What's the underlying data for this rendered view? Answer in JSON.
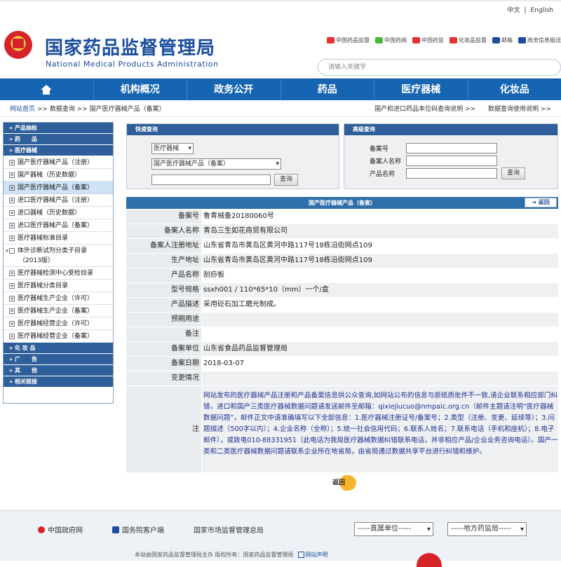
{
  "topbar": {
    "lang_cn": "中文",
    "sep": "|",
    "lang_en": "English"
  },
  "header": {
    "title_cn": "国家药品监督管理局",
    "title_en": "National Medical Products Administration",
    "quick_links": [
      {
        "label": "中国药品监督",
        "icon": "weibo-icon",
        "color": "#e5312f"
      },
      {
        "label": "中国药闻",
        "icon": "wechat-icon",
        "color": "#4bb43a"
      },
      {
        "label": "中国药监",
        "icon": "weibo-icon",
        "color": "#e5312f"
      },
      {
        "label": "化妆品监督",
        "icon": "weibo-icon",
        "color": "#e5312f"
      },
      {
        "label": "邮箱",
        "icon": "mail-icon",
        "color": "#1a4e9d"
      },
      {
        "label": "政务信息报送",
        "icon": "report-icon",
        "color": "#1a4e9d"
      }
    ],
    "search_placeholder": "请输入关键字"
  },
  "nav": {
    "home_icon": "home-icon",
    "items": [
      "机构概况",
      "政务公开",
      "药品",
      "医疗器械",
      "化妆品"
    ]
  },
  "breadcrumb": {
    "home": "网站首页",
    "path": " >> 数据查询 >> 国产医疗器械产品（备案）",
    "right1": "国产和进口药品本位码查询说明 >>",
    "right2": "数据查询使用说明 >>"
  },
  "sidebar": {
    "sec_products": "产品抽检",
    "sec_drugs": "药　　品",
    "sec_devices": "医疗器械",
    "items": [
      "国产医疗器械产品（注册）",
      "国产器械（历史数据）",
      "国产医疗器械产品（备案）",
      "进口医疗器械产品（注册）",
      "进口器械（历史数据）",
      "进口医疗器械产品（备案）",
      "医疗器械标准目录",
      "体外诊断试剂分类子目录（2013版）",
      "医疗器械检测中心受检目录",
      "医疗器械分类目录",
      "医疗器械生产企业（许可）",
      "医疗器械生产企业（备案）",
      "医疗器械经营企业（许可）",
      "医疗器械经营企业（备案）"
    ],
    "sec_cosmetics": "化 妆 品",
    "sec_ads": "广　　告",
    "sec_other": "其　　他",
    "sec_links": "相关链接"
  },
  "quick_search": {
    "title": "快速查询",
    "category": "医疗器械",
    "subcategory": "国产医疗器械产品（备案）",
    "button": "查询"
  },
  "advanced_search": {
    "title": "高级查询",
    "fields": [
      "备案号",
      "备案人名称",
      "产品名称"
    ],
    "button": "查询"
  },
  "detail": {
    "title": "国产医疗器械产品（备案）",
    "back": "返回",
    "rows": [
      {
        "k": "备案号",
        "v": "鲁青械备20180060号"
      },
      {
        "k": "备案人名称",
        "v": "青岛三生如花商贸有限公司"
      },
      {
        "k": "备案人注册地址",
        "v": "山东省青岛市黄岛区黄河中路117号18栋沿街网点109"
      },
      {
        "k": "生产地址",
        "v": "山东省青岛市黄岛区黄河中路117号18栋沿街网点109"
      },
      {
        "k": "产品名称",
        "v": "刮痧板"
      },
      {
        "k": "型号规格",
        "v": "ssxh001 / 110*65*10（mm）一个/盒"
      },
      {
        "k": "产品描述",
        "v": "采用砭石加工磨光制成。"
      },
      {
        "k": "预期用途",
        "v": ""
      },
      {
        "k": "备注",
        "v": ""
      },
      {
        "k": "备案单位",
        "v": "山东省食品药品监督管理局"
      },
      {
        "k": "备案日期",
        "v": "2018-03-07"
      },
      {
        "k": "变更情况",
        "v": ""
      }
    ],
    "note_label": "注",
    "note": "网站发布的医疗器械产品注册和产品备案信息供公众查询,如网站公布的信息与原纸质批件不一致,请企业联系相应部门纠错，进口和国产三类医疗器械数据问题请发送邮件至邮箱：qixiejiucuo@nmpaic.org.cn（邮件主题请注明“医疗器械数据问题”，邮件正文中请准确填写以下全部信息：1.医疗器械注册证号/备案号；2.类型（注册、变更、延续等）；3.问题描述（500字以内）；4.企业名称（全称）；5.统一社会信用代码；6.联系人姓名；7.联系电话（手机和座机）；8.电子邮件），或致电010-88331951（此电话为我局医疗器械数据纠错联系电话，并非相应产品/企业业务咨询电话）。国产一类和二类医疗器械数据问题请联系企业所在地省局，由省局通过数据共享平台进行纠错和维护。",
    "return_label": "返回"
  },
  "footer": {
    "links": [
      {
        "label": "中国政府网",
        "icon": "emblem-icon",
        "color": "#d6232a"
      },
      {
        "label": "国务院客户端",
        "icon": "app-icon",
        "color": "#1a4e9d"
      },
      {
        "label": "国家市场监督管理总局",
        "icon": "",
        "color": ""
      }
    ],
    "select1": "-----直属单位-----",
    "select2": "-----地方药监局-----",
    "copyright": "本站由国家药品监督管理局主办  版权所有：国家药品监督管理局",
    "statement": "网站声明"
  }
}
